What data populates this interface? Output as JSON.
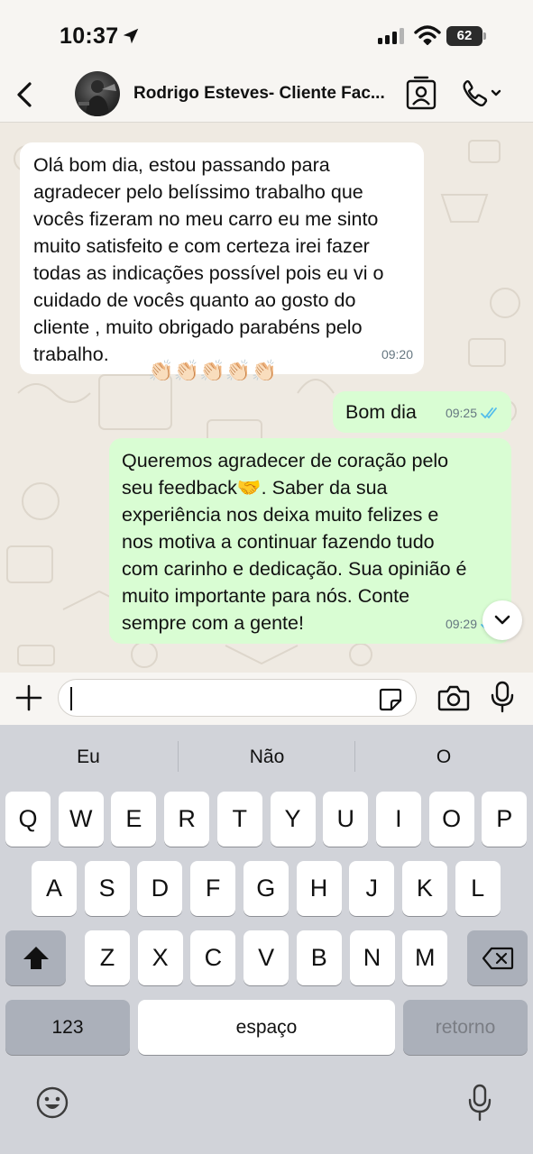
{
  "status_bar": {
    "time": "10:37",
    "battery": "62"
  },
  "header": {
    "contact_name": "Rodrigo Esteves- Cliente Fac..."
  },
  "messages": [
    {
      "direction": "incoming",
      "text": "Olá bom dia, estou passando para\nagradecer pelo belíssimo trabalho que\nvocês fizeram no meu carro eu me sinto\nmuito satisfeito e com certeza irei fazer\ntodas as indicações possível pois eu vi o\ncuidado de vocês quanto ao gosto do\ncliente , muito obrigado parabéns pelo\ntrabalho.",
      "emoji": "👏🏻👏🏻👏🏻👏🏻👏🏻",
      "time": "09:20"
    },
    {
      "direction": "outgoing",
      "text": "Bom dia",
      "time": "09:25",
      "status": "read"
    },
    {
      "direction": "outgoing",
      "text": "Queremos agradecer de coração pelo\nseu feedback🤝. Saber da sua\nexperiência nos deixa muito felizes e\nnos motiva a continuar fazendo tudo\ncom carinho e dedicação. Sua opinião é\nmuito importante para nós. Conte\nsempre com a gente!",
      "time": "09:29",
      "status": "read"
    }
  ],
  "composer": {
    "input_value": ""
  },
  "keyboard": {
    "suggestions": [
      "Eu",
      "Não",
      "O"
    ],
    "row1": [
      "Q",
      "W",
      "E",
      "R",
      "T",
      "Y",
      "U",
      "I",
      "O",
      "P"
    ],
    "row2": [
      "A",
      "S",
      "D",
      "F",
      "G",
      "H",
      "J",
      "K",
      "L"
    ],
    "row3": [
      "Z",
      "X",
      "C",
      "V",
      "B",
      "N",
      "M"
    ],
    "numbers_key": "123",
    "space_key": "espaço",
    "return_key": "retorno"
  },
  "colors": {
    "chat_background": "#efeae2",
    "outgoing_bubble": "#d9fdd3",
    "incoming_bubble": "#ffffff",
    "read_ticks": "#53bdeb",
    "keyboard_background": "#d1d3d9"
  },
  "icons": [
    "location-arrow-icon",
    "signal-icon",
    "wifi-icon",
    "back-icon",
    "contact-card-icon",
    "phone-icon",
    "chevron-down-icon",
    "plus-icon",
    "sticker-icon",
    "camera-icon",
    "mic-icon",
    "shift-icon",
    "backspace-icon",
    "emoji-icon"
  ]
}
